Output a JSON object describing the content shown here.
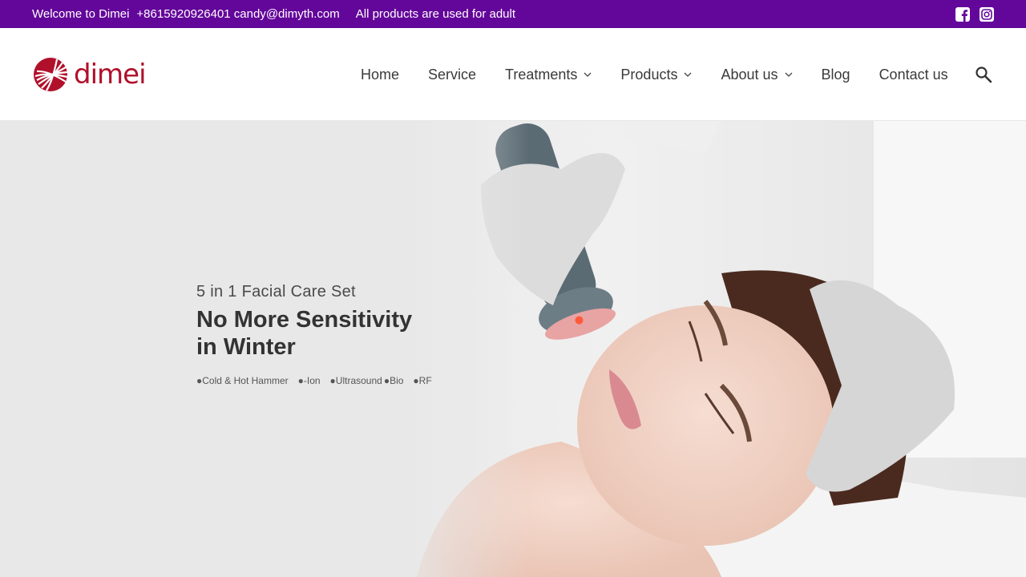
{
  "topbar": {
    "welcome": "Welcome to Dimei",
    "contact": "+8615920926401 candy@dimyth.com",
    "notice": "All products are used for adult",
    "background_color": "#63069a",
    "social": [
      {
        "icon": "facebook-icon"
      },
      {
        "icon": "instagram-icon"
      }
    ]
  },
  "header": {
    "logo_text": "dimei",
    "brand_color": "#b0102a",
    "nav": [
      {
        "label": "Home",
        "has_dropdown": false
      },
      {
        "label": "Service",
        "has_dropdown": false
      },
      {
        "label": "Treatments",
        "has_dropdown": true
      },
      {
        "label": "Products",
        "has_dropdown": true
      },
      {
        "label": "About us",
        "has_dropdown": true
      },
      {
        "label": "Blog",
        "has_dropdown": false
      },
      {
        "label": "Contact us",
        "has_dropdown": false
      }
    ],
    "search_icon": "search-icon"
  },
  "hero": {
    "subtitle": "5 in 1 Facial Care Set",
    "title": "No More Sensitivity in Winter",
    "features": [
      "●Cold & Hot Hammer",
      "●-Ion",
      "●Ultrasound",
      "●Bio",
      "●RF"
    ]
  }
}
